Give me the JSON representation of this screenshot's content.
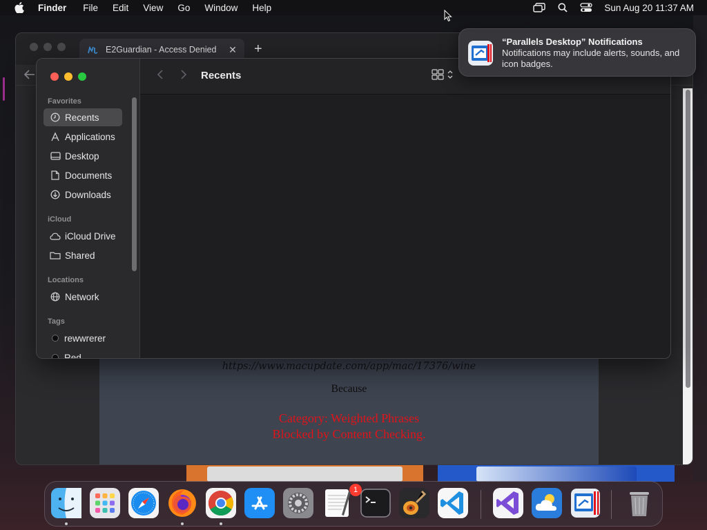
{
  "menubar": {
    "app_name": "Finder",
    "items": [
      "File",
      "Edit",
      "View",
      "Go",
      "Window",
      "Help"
    ],
    "clock": "Sun Aug 20  11:37 AM",
    "status_icons": [
      "screen-mirroring-icon",
      "spotlight-search-icon",
      "control-center-icon"
    ]
  },
  "browser": {
    "tab_title": "E2Guardian - Access Denied",
    "tab_close": "✕",
    "new_tab": "+",
    "blocked_url": "https://www.macupdate.com/app/mac/17376/wine",
    "because": "Because",
    "reason_line1": "Category: Weighted Phrases",
    "reason_line2": "Blocked by Content Checking."
  },
  "finder": {
    "title": "Recents",
    "sections": {
      "favorites": "Favorites",
      "icloud": "iCloud",
      "locations": "Locations",
      "tags": "Tags"
    },
    "favorites": [
      {
        "label": "Recents",
        "icon": "clock-icon",
        "selected": true
      },
      {
        "label": "Applications",
        "icon": "applications-icon"
      },
      {
        "label": "Desktop",
        "icon": "desktop-icon"
      },
      {
        "label": "Documents",
        "icon": "document-icon"
      },
      {
        "label": "Downloads",
        "icon": "downloads-icon"
      }
    ],
    "icloud_items": [
      {
        "label": "iCloud Drive",
        "icon": "cloud-icon"
      },
      {
        "label": "Shared",
        "icon": "shared-folder-icon"
      }
    ],
    "location_items": [
      {
        "label": "Network",
        "icon": "globe-icon"
      }
    ],
    "tag_items": [
      {
        "label": "rewwrerer",
        "color": "#000000"
      },
      {
        "label": "Red",
        "color": "#000000"
      }
    ]
  },
  "notification": {
    "title": "“Parallels Desktop” Notifications",
    "body": "Notifications may include alerts, sounds, and icon badges."
  },
  "dock": {
    "apps": [
      "Finder",
      "Launchpad",
      "Safari",
      "Firefox",
      "Google Chrome",
      "App Store",
      "System Settings",
      "TextEdit",
      "Terminal",
      "GarageBand",
      "Visual Studio Code",
      "Visual Studio",
      "Weather",
      "Parallels Desktop",
      "Trash"
    ],
    "system_settings_badge": "1"
  },
  "colors": {
    "accent_red": "#e0141a",
    "close": "#fe5f57",
    "minimize": "#febc2e",
    "maximize": "#28c840"
  }
}
